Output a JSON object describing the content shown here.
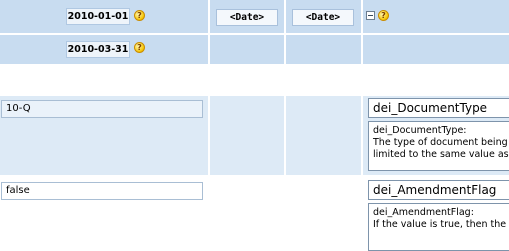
{
  "header": {
    "row1": {
      "date": "2010-01-01",
      "date_placeholder_1": "<Date>",
      "date_placeholder_2": "<Date>",
      "help_glyph": "?"
    },
    "row2": {
      "date": "2010-03-31",
      "help_glyph": "?"
    }
  },
  "concepts": [
    {
      "value": "10-Q",
      "name": "dei_DocumentType",
      "doc_title": "dei_DocumentType:",
      "doc_lines": [
        "The type of document being",
        "limited to the same value as t"
      ]
    },
    {
      "value": "false",
      "name": "dei_AmendmentFlag",
      "doc_title": "dei_AmendmentFlag:",
      "doc_lines": [
        "If the value is true, then the d"
      ]
    }
  ],
  "icons": {
    "help": "help-question-icon",
    "collapse": "collapse-minus-icon"
  },
  "colors": {
    "header_bg": "#c8dcf0",
    "section_bg": "#ddeaf6",
    "help_icon": "#f5c400"
  }
}
